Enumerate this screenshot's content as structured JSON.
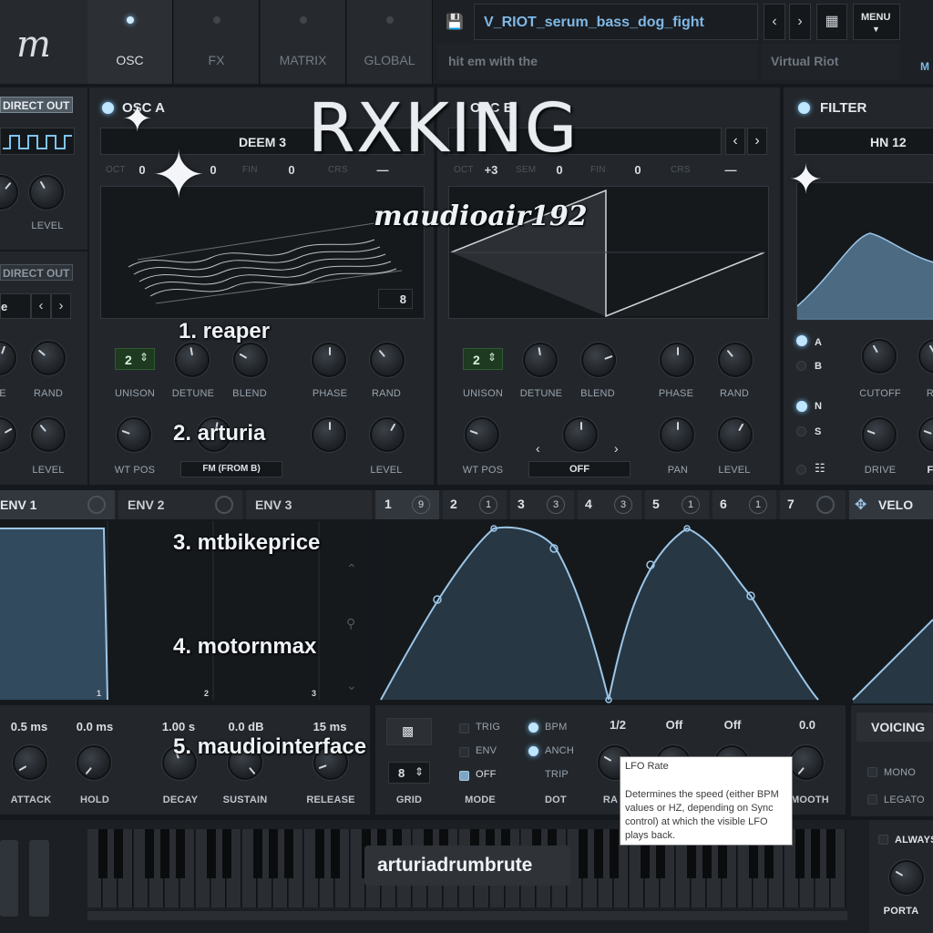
{
  "header": {
    "logo": "m",
    "tabs": [
      {
        "label": "OSC",
        "active": true
      },
      {
        "label": "FX",
        "active": false
      },
      {
        "label": "MATRIX",
        "active": false
      },
      {
        "label": "GLOBAL",
        "active": false
      }
    ],
    "preset_name": "V_RIOT_serum_bass_dog_fight",
    "preset_comment": "hit em with the",
    "author": "Virtual Riot",
    "menu_label": "MENU",
    "right_edge": "M"
  },
  "left_panel": {
    "direct_out_1": "DIRECT OUT",
    "direct_out_2": "DIRECT OUT",
    "level_label": "LEVEL",
    "e_label": "E",
    "rand_label": "RAND",
    "level2_label": "LEVEL",
    "e_value": "e"
  },
  "osc_a": {
    "title": "OSC A",
    "wavetable": "DEEM 3",
    "oct": "OCT",
    "oct_val": "0",
    "sem_val": "0",
    "fin": "FIN",
    "fin_val": "0",
    "crs": "CRS",
    "crs_val": "—",
    "frame": "8",
    "unison": "2",
    "labels": [
      "UNISON",
      "DETUNE",
      "BLEND",
      "PHASE",
      "RAND"
    ],
    "wt_pos": "WT POS",
    "warp": "FM (FROM B)",
    "level": "LEVEL"
  },
  "osc_b": {
    "title": "OSC B",
    "oct": "OCT",
    "oct_val": "+3",
    "sem": "SEM",
    "sem_val": "0",
    "fin": "FIN",
    "fin_val": "0",
    "crs": "CRS",
    "crs_val": "—",
    "unison": "2",
    "labels": [
      "UNISON",
      "DETUNE",
      "BLEND",
      "PHASE",
      "RAND"
    ],
    "wt_pos": "WT POS",
    "warp": "OFF",
    "pan": "PAN",
    "level": "LEVEL"
  },
  "filter": {
    "title": "FILTER",
    "type": "HN 12",
    "route_a": "A",
    "route_b": "B",
    "route_n": "N",
    "route_s": "S",
    "cutoff": "CUTOFF",
    "drive": "DRIVE",
    "r_label": "R",
    "fat_label": "F"
  },
  "mod_tabs": {
    "env1": "ENV 1",
    "env2": "ENV 2",
    "env3": "ENV 3",
    "lfos": [
      {
        "n": "1",
        "c": "9"
      },
      {
        "n": "2",
        "c": "1"
      },
      {
        "n": "3",
        "c": "3"
      },
      {
        "n": "4",
        "c": "3"
      },
      {
        "n": "5",
        "c": "1"
      },
      {
        "n": "6",
        "c": "1"
      },
      {
        "n": "7",
        "c": ""
      }
    ],
    "velo": "VELO"
  },
  "env_params": {
    "values": [
      "0.5 ms",
      "0.0 ms",
      "1.00 s",
      "0.0 dB",
      "15 ms"
    ],
    "labels": [
      "ATTACK",
      "HOLD",
      "DECAY",
      "SUSTAIN",
      "RELEASE"
    ]
  },
  "env_markers": [
    "1",
    "2",
    "3"
  ],
  "lfo_params": {
    "grid_value": "8",
    "grid": "GRID",
    "trig": "TRIG",
    "env": "ENV",
    "off": "OFF",
    "mode": "MODE",
    "bpm": "BPM",
    "anch": "ANCH",
    "trip": "TRIP",
    "dot": "DOT",
    "values": [
      "1/2",
      "Off",
      "Off",
      "0.0"
    ],
    "rate_label": "RA",
    "smooth_label": "MOOTH"
  },
  "tooltip": {
    "title": "LFO Rate",
    "body": "Determines the speed (either BPM values or HZ, depending on Sync control) at which the visible LFO plays back."
  },
  "voicing": {
    "title": "VOICING",
    "mono": "MONO",
    "legato": "LEGATO",
    "always": "ALWAYS",
    "porta": "PORTA"
  },
  "overlay": {
    "brand": "RXKING",
    "handle": "maudioair192",
    "list": [
      "1. reaper",
      "2. arturia",
      "3. mtbikeprice",
      "4. motornmax",
      "5. maudiointerface"
    ],
    "footer": "arturiadrumbrute"
  },
  "colors": {
    "accent": "#9ccbed",
    "led": "#bfe6ff",
    "preset_text": "#7fb8e6",
    "bg": "#23272c"
  }
}
